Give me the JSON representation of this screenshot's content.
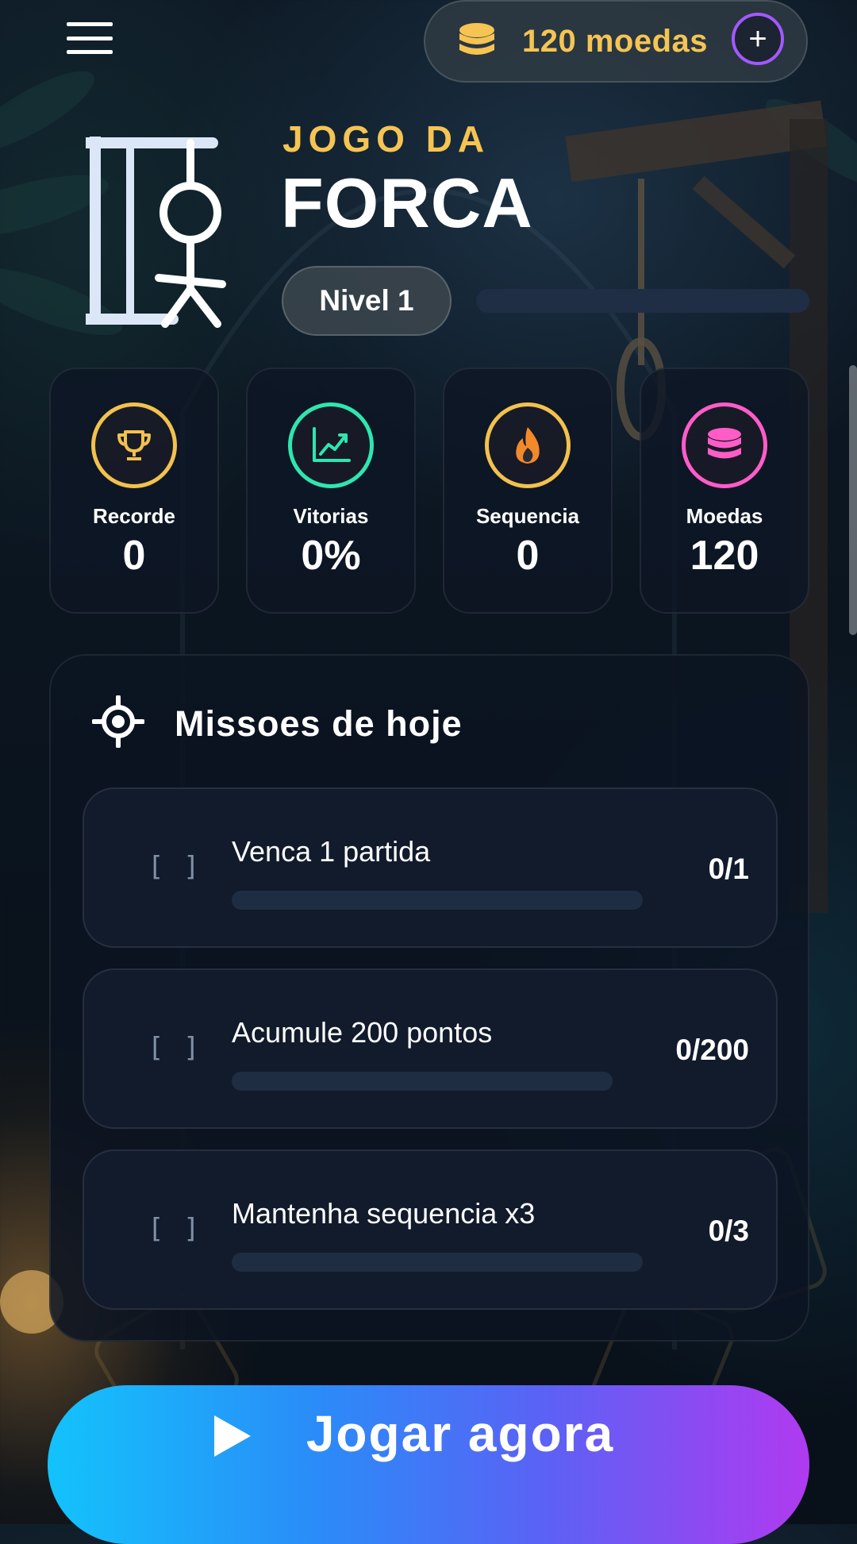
{
  "topbar": {
    "menu_icon": "hamburger-menu-icon",
    "coins_label": "120 moedas",
    "coin_icon": "coin-stack-icon",
    "add_icon": "plus-icon",
    "add_symbol": "+"
  },
  "header": {
    "logo_icon": "hangman-gallows-icon",
    "title_small": "JOGO DA",
    "title_big": "FORCA",
    "level_label": "Nivel 1",
    "level_progress": 0
  },
  "stats": [
    {
      "label": "Recorde",
      "value": "0",
      "icon": "trophy-icon",
      "color": "#f2c14e"
    },
    {
      "label": "Vitorias",
      "value": "0%",
      "icon": "chart-up-icon",
      "color": "#2ee6b0"
    },
    {
      "label": "Sequencia",
      "value": "0",
      "icon": "flame-icon",
      "color": "#f2c14e"
    },
    {
      "label": "Moedas",
      "value": "120",
      "icon": "coin-stack-icon",
      "color": "#ff5cc8"
    }
  ],
  "missions": {
    "icon": "target-icon",
    "heading": "Missoes de hoje",
    "items": [
      {
        "check": "[ ]",
        "title": "Venca 1 partida",
        "progress": "0/1",
        "fraction": 0
      },
      {
        "check": "[ ]",
        "title": "Acumule 200 pontos",
        "progress": "0/200",
        "fraction": 0
      },
      {
        "check": "[ ]",
        "title": "Mantenha sequencia x3",
        "progress": "0/3",
        "fraction": 0
      }
    ]
  },
  "play": {
    "icon": "play-icon",
    "label": "Jogar agora"
  },
  "colors": {
    "accent_gold": "#f5c453",
    "accent_purple": "#a259ff",
    "play_gradient_start": "#13c3fb",
    "play_gradient_end": "#b03af0"
  }
}
